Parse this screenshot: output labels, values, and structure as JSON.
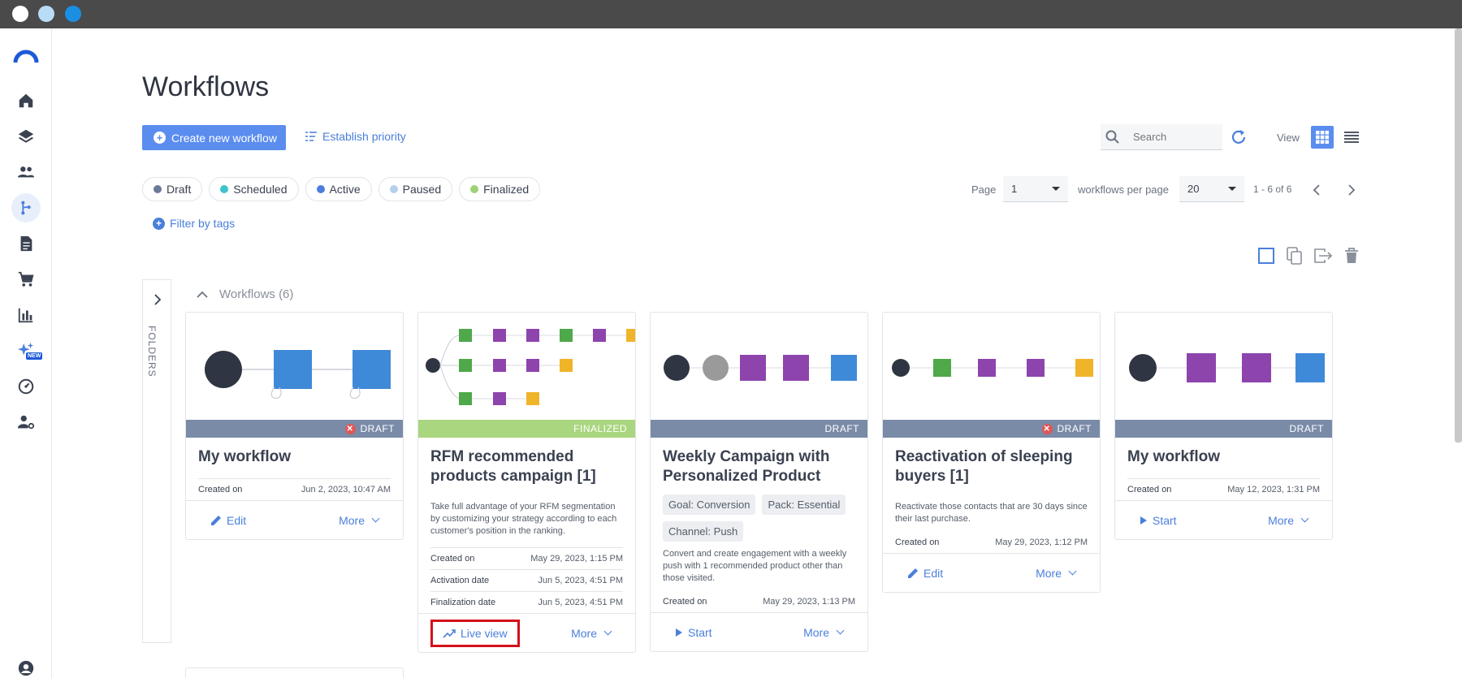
{
  "window": {
    "dots": [
      "#ffffff",
      "#b8dcf5",
      "#1a8fe3"
    ]
  },
  "sidebar": {
    "items": [
      {
        "name": "home-icon",
        "active": false
      },
      {
        "name": "layers-icon",
        "active": false
      },
      {
        "name": "contacts-icon",
        "active": false
      },
      {
        "name": "workflow-icon",
        "active": true
      },
      {
        "name": "document-icon",
        "active": false
      },
      {
        "name": "cart-icon",
        "active": false
      },
      {
        "name": "analytics-icon",
        "active": false
      },
      {
        "name": "ai-sparkle-icon",
        "active": false,
        "badge": "NEW"
      },
      {
        "name": "dashboard-gauge-icon",
        "active": false
      },
      {
        "name": "user-settings-icon",
        "active": false
      },
      {
        "name": "account-icon",
        "active": false
      }
    ]
  },
  "page": {
    "title": "Workflows"
  },
  "toolbar": {
    "create_label": "Create new workflow",
    "priority_label": "Establish priority",
    "search_placeholder": "Search",
    "view_label": "View"
  },
  "status_filters": [
    {
      "label": "Draft",
      "color": "#6b7a99"
    },
    {
      "label": "Scheduled",
      "color": "#3cc4cc"
    },
    {
      "label": "Active",
      "color": "#4a7fdb"
    },
    {
      "label": "Paused",
      "color": "#b5cfee"
    },
    {
      "label": "Finalized",
      "color": "#9ed276"
    }
  ],
  "filter_tags_label": "Filter by tags",
  "pagination": {
    "page_label": "Page",
    "page_value": "1",
    "per_page_label": "workflows per page",
    "per_page_value": "20",
    "range_text": "1 - 6 of 6"
  },
  "folders_label": "FOLDERS",
  "group": {
    "title": "Workflows (6)"
  },
  "cards": [
    {
      "status": "DRAFT",
      "status_color": "#7a8ba8",
      "error": true,
      "title": "My workflow",
      "description": "",
      "tags": [],
      "meta": [
        {
          "label": "Created on",
          "value": "Jun 2, 2023, 10:47 AM"
        }
      ],
      "primary_action": "Edit",
      "more_label": "More"
    },
    {
      "status": "FINALIZED",
      "status_color": "#a9d67f",
      "error": false,
      "title": "RFM recommended products campaign [1]",
      "description": "Take full advantage of your RFM segmentation by customizing your strategy according to each customer's position in the ranking.",
      "tags": [],
      "meta": [
        {
          "label": "Created on",
          "value": "May 29, 2023, 1:15 PM"
        },
        {
          "label": "Activation date",
          "value": "Jun 5, 2023, 4:51 PM"
        },
        {
          "label": "Finalization date",
          "value": "Jun 5, 2023, 4:51 PM"
        }
      ],
      "primary_action": "Live view",
      "more_label": "More"
    },
    {
      "status": "DRAFT",
      "status_color": "#7a8ba8",
      "error": false,
      "title": "Weekly Campaign with Personalized Product",
      "description": "Convert and create engagement with a weekly push with 1 recommended product other than those visited.",
      "tags": [
        "Goal: Conversion",
        "Pack: Essential",
        "Channel: Push"
      ],
      "meta": [
        {
          "label": "Created on",
          "value": "May 29, 2023, 1:13 PM"
        }
      ],
      "primary_action": "Start",
      "more_label": "More"
    },
    {
      "status": "DRAFT",
      "status_color": "#7a8ba8",
      "error": true,
      "title": "Reactivation of sleeping buyers [1]",
      "description": "Reactivate those contacts that are 30 days since their last purchase.",
      "tags": [],
      "meta": [
        {
          "label": "Created on",
          "value": "May 29, 2023, 1:12 PM"
        }
      ],
      "primary_action": "Edit",
      "more_label": "More"
    },
    {
      "status": "DRAFT",
      "status_color": "#7a8ba8",
      "error": false,
      "title": "My workflow",
      "description": "",
      "tags": [],
      "meta": [
        {
          "label": "Created on",
          "value": "May 12, 2023, 1:31 PM"
        }
      ],
      "primary_action": "Start",
      "more_label": "More"
    }
  ]
}
